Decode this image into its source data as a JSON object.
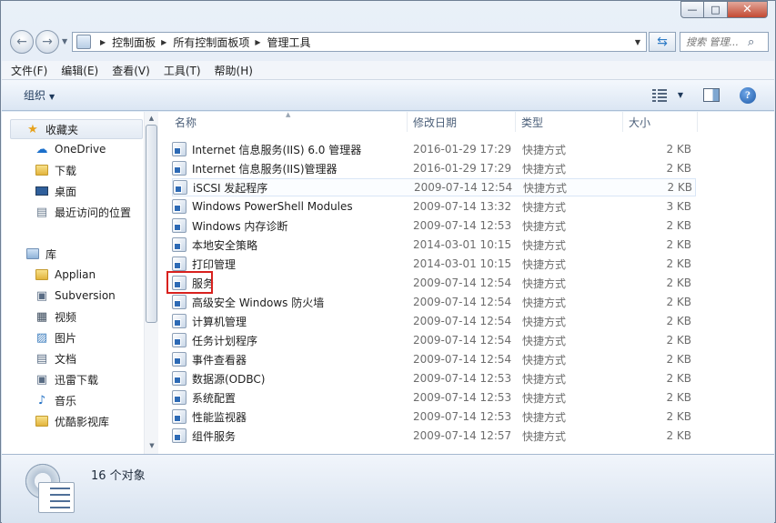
{
  "window": {
    "minimize_glyph": "—",
    "maximize_glyph": "□",
    "close_glyph": "✕"
  },
  "nav": {
    "breadcrumbs": [
      "控制面板",
      "所有控制面板项",
      "管理工具"
    ],
    "search_placeholder": "搜索 管理...",
    "back_glyph": "←",
    "forward_glyph": "→"
  },
  "menu": [
    "文件(F)",
    "编辑(E)",
    "查看(V)",
    "工具(T)",
    "帮助(H)"
  ],
  "toolbar": {
    "organize_label": "组织",
    "help_glyph": "?"
  },
  "sidebar": {
    "favorites": {
      "label": "收藏夹",
      "icon": "star-icon"
    },
    "favorites_items": [
      {
        "label": "OneDrive",
        "icon": "cloud-icon"
      },
      {
        "label": "下载",
        "icon": "download-folder-icon"
      },
      {
        "label": "桌面",
        "icon": "desktop-icon"
      },
      {
        "label": "最近访问的位置",
        "icon": "recent-places-icon"
      }
    ],
    "libraries": {
      "label": "库",
      "icon": "library-icon"
    },
    "library_items": [
      {
        "label": "Applian",
        "icon": "folder-icon"
      },
      {
        "label": "Subversion",
        "icon": "library-doc-icon"
      },
      {
        "label": "视频",
        "icon": "video-icon"
      },
      {
        "label": "图片",
        "icon": "picture-icon"
      },
      {
        "label": "文档",
        "icon": "document-icon"
      },
      {
        "label": "迅雷下载",
        "icon": "library-doc-icon"
      },
      {
        "label": "音乐",
        "icon": "music-icon"
      },
      {
        "label": "优酷影视库",
        "icon": "folder-icon"
      }
    ]
  },
  "columns": {
    "name": "名称",
    "date": "修改日期",
    "type": "类型",
    "size": "大小"
  },
  "files": [
    {
      "name": "Internet 信息服务(IIS) 6.0 管理器",
      "date": "2016-01-29 17:29",
      "type": "快捷方式",
      "size": "2 KB"
    },
    {
      "name": "Internet 信息服务(IIS)管理器",
      "date": "2016-01-29 17:29",
      "type": "快捷方式",
      "size": "2 KB"
    },
    {
      "name": "iSCSI 发起程序",
      "date": "2009-07-14 12:54",
      "type": "快捷方式",
      "size": "2 KB"
    },
    {
      "name": "Windows PowerShell Modules",
      "date": "2009-07-14 13:32",
      "type": "快捷方式",
      "size": "3 KB"
    },
    {
      "name": "Windows 内存诊断",
      "date": "2009-07-14 12:53",
      "type": "快捷方式",
      "size": "2 KB"
    },
    {
      "name": "本地安全策略",
      "date": "2014-03-01 10:15",
      "type": "快捷方式",
      "size": "2 KB"
    },
    {
      "name": "打印管理",
      "date": "2014-03-01 10:15",
      "type": "快捷方式",
      "size": "2 KB"
    },
    {
      "name": "服务",
      "date": "2009-07-14 12:54",
      "type": "快捷方式",
      "size": "2 KB"
    },
    {
      "name": "高级安全 Windows 防火墙",
      "date": "2009-07-14 12:54",
      "type": "快捷方式",
      "size": "2 KB"
    },
    {
      "name": "计算机管理",
      "date": "2009-07-14 12:54",
      "type": "快捷方式",
      "size": "2 KB"
    },
    {
      "name": "任务计划程序",
      "date": "2009-07-14 12:54",
      "type": "快捷方式",
      "size": "2 KB"
    },
    {
      "name": "事件查看器",
      "date": "2009-07-14 12:54",
      "type": "快捷方式",
      "size": "2 KB"
    },
    {
      "name": "数据源(ODBC)",
      "date": "2009-07-14 12:53",
      "type": "快捷方式",
      "size": "2 KB"
    },
    {
      "name": "系统配置",
      "date": "2009-07-14 12:53",
      "type": "快捷方式",
      "size": "2 KB"
    },
    {
      "name": "性能监视器",
      "date": "2009-07-14 12:53",
      "type": "快捷方式",
      "size": "2 KB"
    },
    {
      "name": "组件服务",
      "date": "2009-07-14 12:57",
      "type": "快捷方式",
      "size": "2 KB"
    }
  ],
  "details": {
    "count_text": "16 个对象"
  },
  "colors": {
    "highlight_box": "#d8211e",
    "accent": "#2d6ab5"
  }
}
